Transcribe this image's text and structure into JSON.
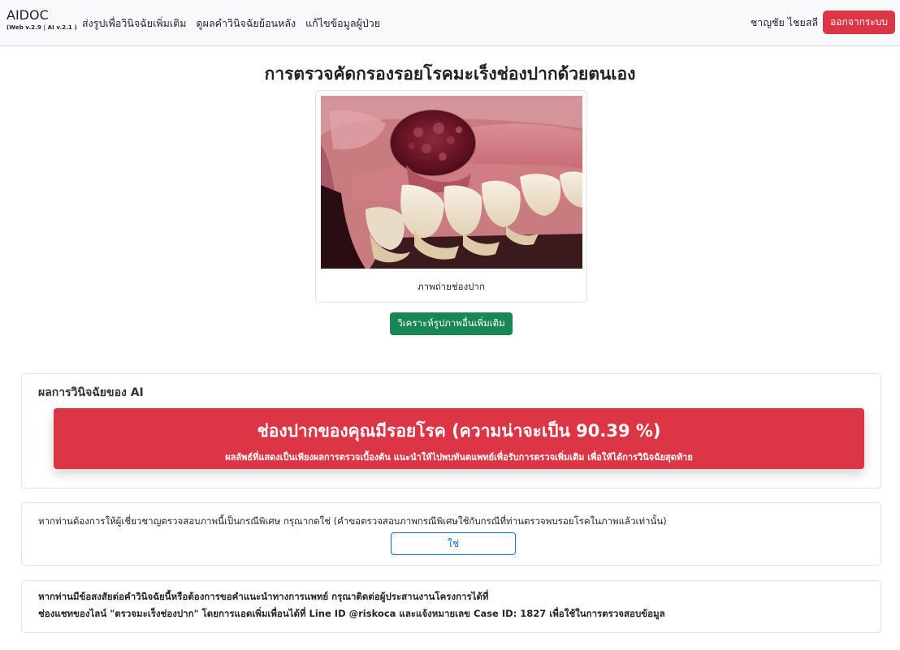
{
  "navbar": {
    "brand": "AIDOC",
    "version": "(Web v.2.9 | AI v.2.1 )",
    "links": [
      "ส่งรูปเพื่อวินิจฉัยเพิ่มเติม",
      "ดูผลคำวินิจฉัยย้อนหลัง",
      "แก้ไขข้อมูลผู้ป่วย"
    ],
    "user_name": "ชาญชัย ไชยสลี",
    "logout_label": "ออกจากระบบ"
  },
  "page": {
    "title": "การตรวจคัดกรองรอยโรคมะเร็งช่องปากด้วยตนเอง",
    "photo_caption": "ภาพถ่ายช่องปาก",
    "analyze_button": "วิเคราะห์รูปภาพอื่นเพิ่มเติม"
  },
  "result": {
    "heading": "ผลการวินิจฉัยของ AI",
    "main": "ช่องปากของคุณมีรอยโรค (ความน่าจะเป็น 90.39 %)",
    "note": "ผลลัพธ์ที่แสดงเป็นเพียงผลการตรวจเบื้องต้น แนะนำให้ไปพบทันตแพทย์เพื่อรับการตรวจเพิ่มเติม เพื่อให้ได้การวินิจฉัยสุดท้าย",
    "alert_color": "#dc3545"
  },
  "expert_review": {
    "text": "หากท่านต้องการให้ผู้เชี่ยวชาญตรวจสอบภาพนี้เป็นกรณีพิเศษ กรุณากดใช่ (คำขอตรวจสอบภาพกรณีพิเศษใช้กับกรณีที่ท่านตรวจพบรอยโรคในภาพแล้วเท่านั้น)",
    "yes_button": "ใช่"
  },
  "contact": {
    "line1": "หากท่านมีข้อสงสัยต่อคำวินิจฉัยนี้หรือต้องการขอคำแนะนำทางการแพทย์ กรุณาติดต่อผู้ประสานงานโครงการได้ที่",
    "line2": "ช่องแชทของไลน์ \"ตรวจมะเร็งช่องปาก\" โดยการแอดเพิ่มเพื่อนได้ที่ Line ID @riskoca และแจ้งหมายเลข Case ID: 1827 เพื่อใช้ในการตรวจสอบข้อมูล"
  }
}
